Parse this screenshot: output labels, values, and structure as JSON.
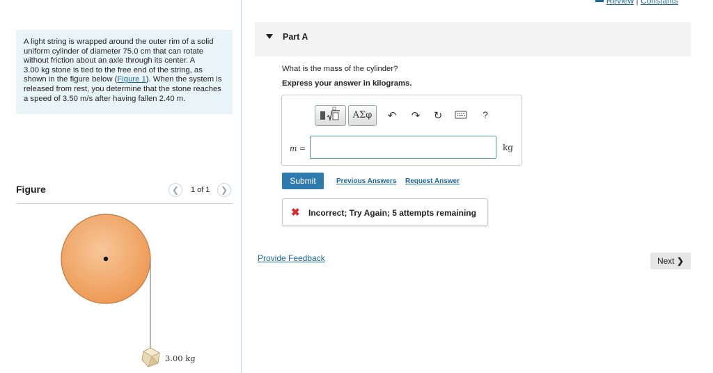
{
  "top_links": {
    "review": "Review",
    "separator": "|",
    "constants": "Constants"
  },
  "problem": {
    "lines": [
      "A light string is wrapped around the outer rim of a solid",
      "uniform cylinder of diameter 75.0 cm that can rotate",
      "without friction about an axle through its center. A",
      "3.00 kg stone is tied to the free end of the string, as",
      "released from rest, you determine that the stone reaches",
      "a speed of 3.50 m/s after having fallen 2.40 m."
    ],
    "line5_before": "shown in the figure below (",
    "figure_link": "Figure 1",
    "line5_after": "). When the system is"
  },
  "figure": {
    "title": "Figure",
    "page_indicator": "1 of 1",
    "prev_icon": "chevron-left-icon",
    "next_icon": "chevron-right-icon",
    "stone_label": "3.00 kg",
    "cylinder_color": "#f0a464",
    "stone_color": "#e4d3a8"
  },
  "part": {
    "title": "Part A",
    "caret_icon": "caret-down-icon"
  },
  "question": "What is the mass of the cylinder?",
  "instruction": "Express your answer in kilograms.",
  "answer": {
    "variable_label": "m =",
    "value": "",
    "unit": "kg",
    "toolbar": {
      "templates_icon": "templates-icon",
      "greek_label": "ΑΣφ",
      "undo_icon": "undo-icon",
      "redo_icon": "redo-icon",
      "reset_icon": "reset-icon",
      "keyboard_icon": "keyboard-icon",
      "help_label": "?"
    }
  },
  "actions": {
    "submit_label": "Submit",
    "previous_answers": "Previous Answers",
    "request_answer": "Request Answer"
  },
  "feedback": {
    "icon": "x-icon",
    "message": "Incorrect; Try Again; 5 attempts remaining",
    "color": "#d42a2a"
  },
  "provide_feedback": "Provide Feedback",
  "next_label": "Next",
  "accent": "#2f7bb0"
}
